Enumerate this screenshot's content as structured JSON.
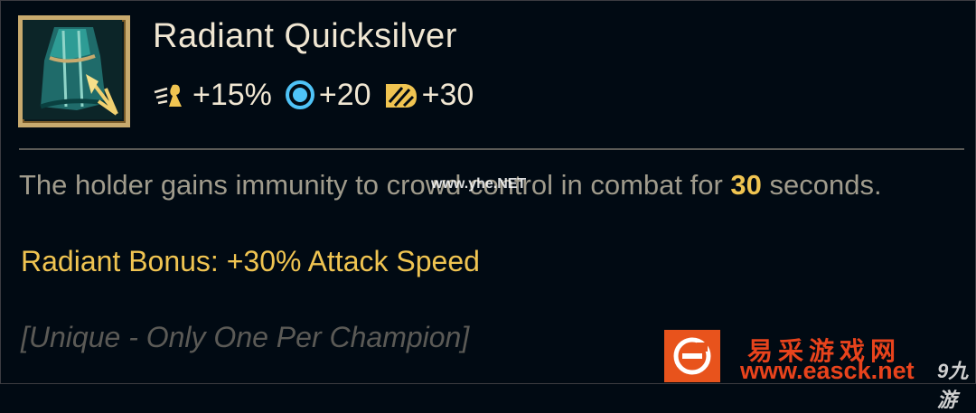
{
  "item": {
    "name": "Radiant Quicksilver",
    "icon": "quicksilver-cloak-icon"
  },
  "stats": [
    {
      "icon": "attack-speed-icon",
      "value": "+15%",
      "color": "#f0e6d2"
    },
    {
      "icon": "magic-resist-icon",
      "value": "+20",
      "color": "#4fc3f7"
    },
    {
      "icon": "crit-chance-icon",
      "value": "+30",
      "color": "#f0c451"
    }
  ],
  "description": {
    "before": "The holder gains immunity to crowd control in combat for ",
    "highlight": "30",
    "after": " seconds."
  },
  "bonus": "Radiant Bonus: +30% Attack Speed",
  "unique": "[Unique - Only One Per Champion]",
  "watermarks": {
    "overlay_text": "www.yhe.NET",
    "site_name_cn": "易采游戏网",
    "site_url": "www.easck.net",
    "corner_text": "9九游"
  },
  "colors": {
    "background": "#010a13",
    "gold": "#c8aa6e",
    "highlight": "#f0c451",
    "text_primary": "#f0e6d2",
    "text_secondary": "#a09b8c",
    "text_muted": "#5b5a56"
  }
}
